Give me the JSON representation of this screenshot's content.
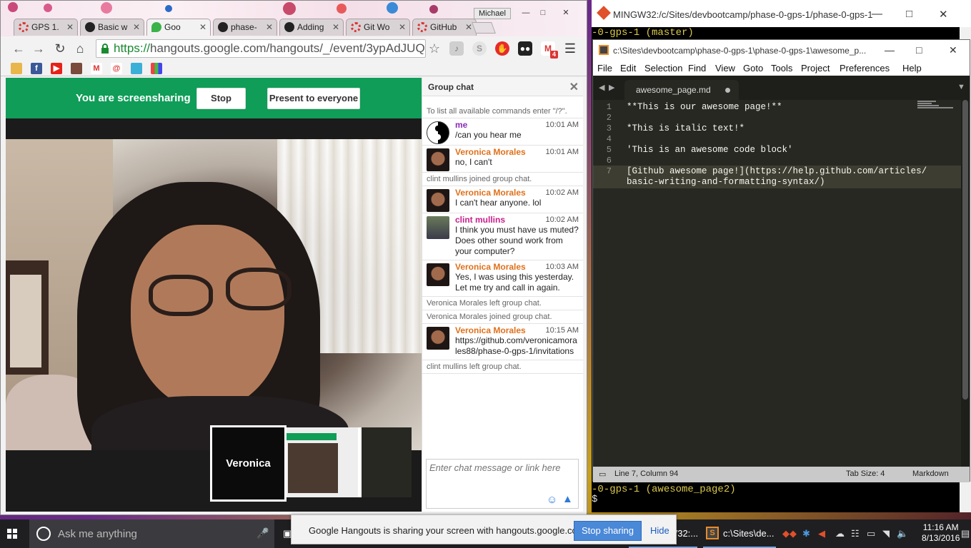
{
  "chrome": {
    "profile": "Michael",
    "tabs": [
      {
        "label": "GPS 1.",
        "icon": "red"
      },
      {
        "label": "Basic w",
        "icon": "gh"
      },
      {
        "label": "Goo",
        "icon": "green"
      },
      {
        "label": "phase-",
        "icon": "gh"
      },
      {
        "label": "Adding",
        "icon": "gh"
      },
      {
        "label": "Git Wo",
        "icon": "red"
      },
      {
        "label": "GitHub",
        "icon": "red"
      }
    ],
    "url_https": "https://",
    "url_rest": "hangouts.google.com/hangouts/_/event/3ypAdJUQ",
    "extensions": [
      "sound-icon",
      "skype-icon",
      "stop-icon",
      "spy-icon",
      "gmail-icon",
      "menu-icon"
    ],
    "gmail_badge": "4"
  },
  "hangouts": {
    "share_text": "You are screensharing",
    "stop_label": "Stop",
    "present_label": "Present to everyone",
    "tile_name": "Veronica"
  },
  "chat": {
    "title": "Group chat",
    "hint": "To list all available commands enter \"/?\".",
    "messages": [
      {
        "type": "msg",
        "who": "me",
        "color": "purple",
        "avatar": "yin",
        "time": "10:01 AM",
        "text": "/can you hear me"
      },
      {
        "type": "msg",
        "who": "Veronica Morales",
        "color": "orange",
        "avatar": "ver",
        "time": "10:01 AM",
        "text": "no, I can't"
      },
      {
        "type": "sys",
        "text": "clint mullins joined group chat."
      },
      {
        "type": "msg",
        "who": "Veronica Morales",
        "color": "orange",
        "avatar": "ver",
        "time": "10:02 AM",
        "text": "I can't hear anyone. lol"
      },
      {
        "type": "msg",
        "who": "clint mullins",
        "color": "magenta",
        "avatar": "clint",
        "time": "10:02 AM",
        "text": "I think you must have us muted?\nDoes other sound work from your computer?"
      },
      {
        "type": "msg",
        "who": "Veronica Morales",
        "color": "orange",
        "avatar": "ver",
        "time": "10:03 AM",
        "text": "Yes, I was using this yesterday. Let me try and call in again."
      },
      {
        "type": "sys",
        "text": "Veronica Morales left group chat."
      },
      {
        "type": "sys",
        "text": "Veronica Morales joined group chat."
      },
      {
        "type": "msg",
        "who": "Veronica Morales",
        "color": "orange",
        "avatar": "ver",
        "time": "10:15 AM",
        "link": "https://github.com/veronicamorales88/phase-0-gps-1/invitations"
      },
      {
        "type": "sys",
        "text": "clint mullins left group chat."
      }
    ],
    "input_placeholder": "Enter chat message or link here"
  },
  "mingw": {
    "title": "MINGW32:/c/Sites/devbootcamp/phase-0-gps-1/phase-0-gps-1",
    "line_top": "-0-gps-1 (master)",
    "line_bottom": "-0-gps-1 (awesome_page2)",
    "prompt": "$"
  },
  "sublime": {
    "title": "c:\\Sites\\devbootcamp\\phase-0-gps-1\\phase-0-gps-1\\awesome_p...",
    "menu": [
      "File",
      "Edit",
      "Selection",
      "Find",
      "View",
      "Goto",
      "Tools",
      "Project",
      "Preferences",
      "Help"
    ],
    "tab": "awesome_page.md",
    "lines": [
      {
        "n": "1",
        "text": "**This is our awesome page!**"
      },
      {
        "n": "2",
        "text": ""
      },
      {
        "n": "3",
        "text": "*This is italic text!*"
      },
      {
        "n": "4",
        "text": ""
      },
      {
        "n": "5",
        "text": "'This is an awesome code block'"
      },
      {
        "n": "6",
        "text": ""
      },
      {
        "n": "7",
        "text": "[Github awesome page!](https://help.github.com/articles/\nbasic-writing-and-formatting-syntax/)"
      }
    ],
    "status_pos": "Line 7, Column 94",
    "status_tab": "Tab Size: 4",
    "status_syntax": "Markdown"
  },
  "sharebar": {
    "message": "Google Hangouts is sharing your screen with hangouts.google.com.",
    "stop": "Stop sharing",
    "hide": "Hide"
  },
  "taskbar": {
    "search": "Ask me anything",
    "tasks": [
      {
        "label": "MINGW32:...",
        "icon": "diamond"
      },
      {
        "label": "c:\\Sites\\de...",
        "icon": "sublime"
      }
    ],
    "time": "11:16 AM",
    "date": "8/13/2016"
  }
}
